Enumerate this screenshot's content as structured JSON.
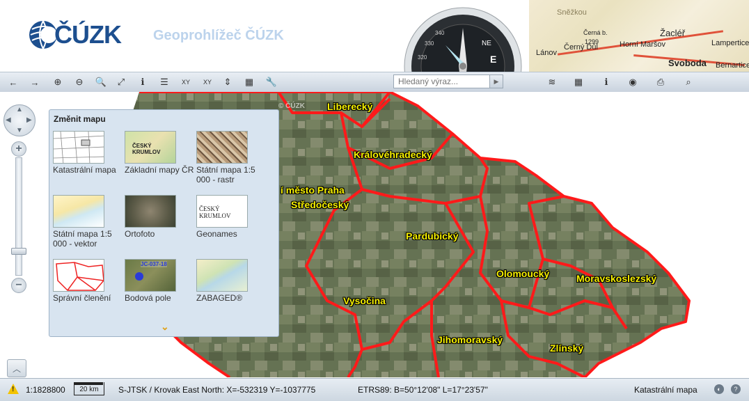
{
  "header": {
    "logo_text": "ČÚZK",
    "app_title": "Geoprohlížeč ČÚZK",
    "map_labels": [
      "Sněžkou",
      "Žacléř",
      "Černá b.",
      "1299",
      "Horní Maršov",
      "Lampertice",
      "Lánov",
      "Černý Důl",
      "Svoboda",
      "Bernartice"
    ],
    "compass_marks": [
      "NE",
      "E",
      "320",
      "330",
      "340"
    ]
  },
  "toolbar": {
    "buttons": [
      {
        "name": "back-button",
        "icon": "←"
      },
      {
        "name": "forward-button",
        "icon": "→"
      },
      {
        "name": "zoom-in-button",
        "icon": "⊕"
      },
      {
        "name": "zoom-out-button",
        "icon": "⊖"
      },
      {
        "name": "zoom-window-button",
        "icon": "🔍"
      },
      {
        "name": "full-extent-button",
        "icon": "⤢"
      },
      {
        "name": "info-button",
        "icon": "ℹ"
      },
      {
        "name": "legend-button",
        "icon": "☰"
      },
      {
        "name": "xy-button",
        "icon": "XY"
      },
      {
        "name": "xy-search-button",
        "icon": "XY"
      },
      {
        "name": "measure-distance-button",
        "icon": "⇕"
      },
      {
        "name": "measure-area-button",
        "icon": "▦"
      },
      {
        "name": "tools-button",
        "icon": "🔧"
      }
    ],
    "search_placeholder": "Hledaný výraz...",
    "right_buttons": [
      {
        "name": "layers-button",
        "icon": "≋"
      },
      {
        "name": "grid-button",
        "icon": "▦"
      },
      {
        "name": "about-button",
        "icon": "ℹ"
      },
      {
        "name": "services-button",
        "icon": "◉"
      },
      {
        "name": "print-button",
        "icon": "⎙"
      },
      {
        "name": "find-button",
        "icon": "⌕"
      }
    ]
  },
  "map": {
    "watermark": "© ČÚZK",
    "regions": [
      {
        "label": "Liberecký"
      },
      {
        "label": "Královéhradecký"
      },
      {
        "label": "í město Praha"
      },
      {
        "label": "Středočeský"
      },
      {
        "label": "Pardubický"
      },
      {
        "label": "Vysočina"
      },
      {
        "label": "Olomoucký"
      },
      {
        "label": "Moravskoslezský"
      },
      {
        "label": "Jihomoravský"
      },
      {
        "label": "Zlínský"
      }
    ],
    "zoom_level_fraction": 0.2
  },
  "panel": {
    "title": "Změnit mapu",
    "tiles": [
      {
        "label": "Katastrální mapa",
        "thumb_text": ""
      },
      {
        "label": "Základní mapy ČR",
        "thumb_text": "ČESKÝ KRUMLOV"
      },
      {
        "label": "Státní mapa 1:5 000 - rastr",
        "thumb_text": ""
      },
      {
        "label": "Státní mapa 1:5 000 - vektor",
        "thumb_text": ""
      },
      {
        "label": "Ortofoto",
        "thumb_text": ""
      },
      {
        "label": "Geonames",
        "thumb_text": "ČESKÝ KRUMLOV"
      },
      {
        "label": "Správní členění",
        "thumb_text": ""
      },
      {
        "label": "Bodová pole",
        "thumb_text": "JC-037-18"
      },
      {
        "label": "ZABAGED®",
        "thumb_text": ""
      }
    ],
    "more_icon": "⌄"
  },
  "status": {
    "scale": "1:1828800",
    "scalebar": "20 km",
    "coords_sjtsk": "S-JTSK / Krovak East North: X=-532319 Y=-1037775",
    "coords_etrs": "ETRS89: B=50°12'08\" L=17°23'57\"",
    "active_map": "Katastrální mapa"
  },
  "colors": {
    "brand": "#1d4f8f",
    "border": "#ff1a1a",
    "label": "#f6f000"
  }
}
